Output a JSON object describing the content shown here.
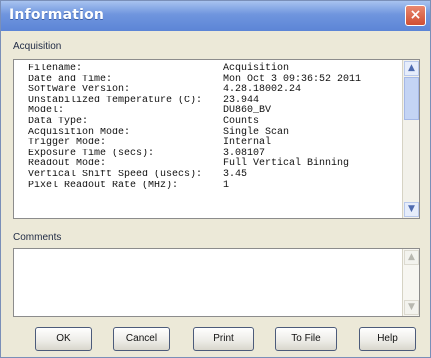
{
  "window": {
    "title": "Information",
    "close_glyph": "×"
  },
  "acquisition": {
    "label": "Acquisition",
    "rows": [
      {
        "key": "Filename:",
        "value": "Acquisition"
      },
      {
        "key": "Date and Time:",
        "value": "Mon Oct  3 09:36:52 2011"
      },
      {
        "key": "Software Version:",
        "value": "4.28.18002.24"
      },
      {
        "key": "Unstabilized Temperature (C):",
        "value": "23.944"
      },
      {
        "key": "Model:",
        "value": "DU860_BV"
      },
      {
        "key": "Data Type:",
        "value": "Counts"
      },
      {
        "key": "Acquisition Mode:",
        "value": "Single Scan"
      },
      {
        "key": "Trigger Mode:",
        "value": "Internal"
      },
      {
        "key": "Exposure Time (secs):",
        "value": "3.08107"
      },
      {
        "key": "Readout Mode:",
        "value": "Full Vertical Binning"
      },
      {
        "key": "Vertical Shift Speed (usecs):",
        "value": "3.45"
      },
      {
        "key": "Pixel Readout Rate (MHz):",
        "value": "1"
      }
    ]
  },
  "comments": {
    "label": "Comments",
    "value": ""
  },
  "buttons": {
    "ok": "OK",
    "cancel": "Cancel",
    "print": "Print",
    "to_file": "To File",
    "help": "Help"
  },
  "icons": {
    "scroll_up": "chevron-up-icon",
    "scroll_down": "chevron-down-icon"
  }
}
